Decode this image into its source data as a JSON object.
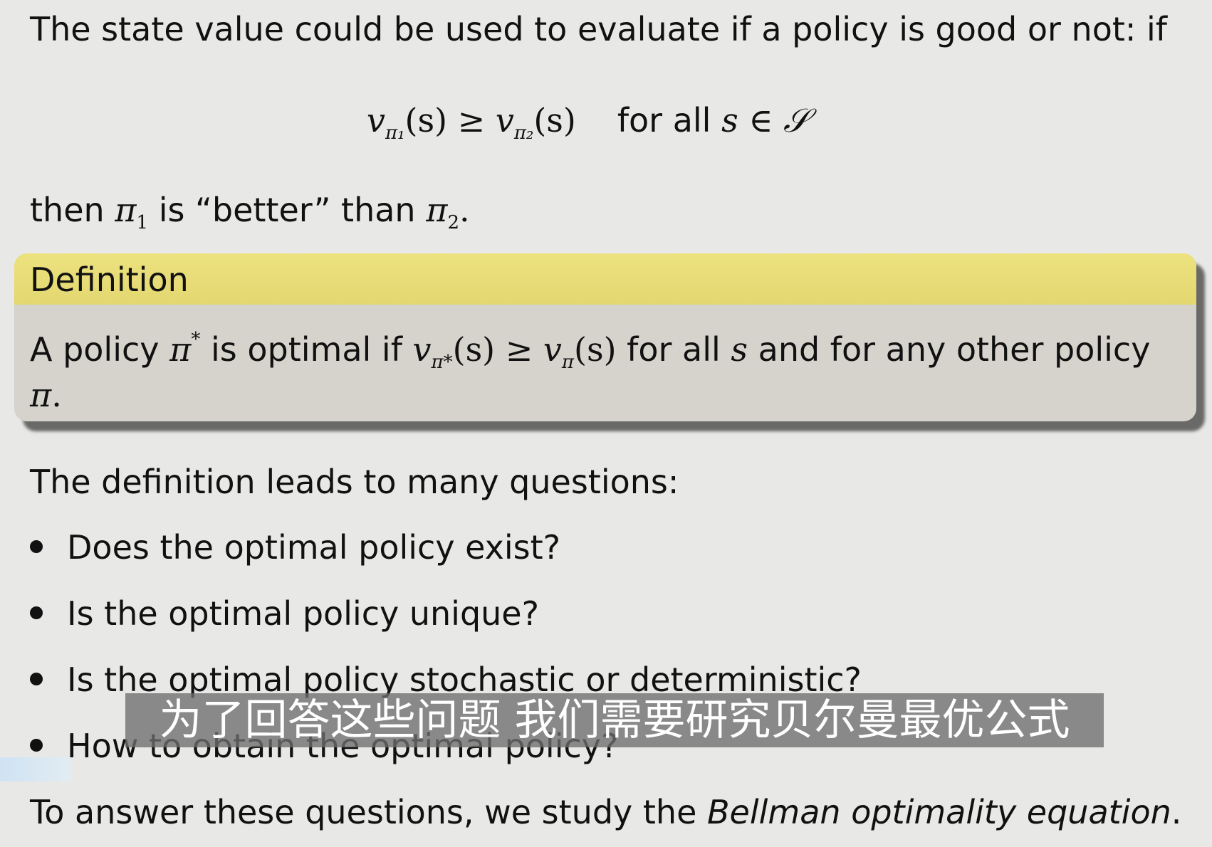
{
  "intro": "The state value could be used to evaluate if a policy is good or not:  if",
  "display": {
    "lhs": "v",
    "lhs_sub": "π₁",
    "arg": "(s)",
    "rel": "≥",
    "rhs": "v",
    "rhs_sub": "π₂",
    "arg2": "(s)",
    "text": "for all",
    "var": "s",
    "in": "∈",
    "set": "𝒮"
  },
  "then_line": {
    "pre": "then",
    "pi1": "π",
    "pi1_sub": "1",
    "mid": "is “better” than",
    "pi2": "π",
    "pi2_sub": "2",
    "end": "."
  },
  "definition": {
    "title": "Definition",
    "l1_a": "A policy",
    "l1_pi": "π",
    "l1_star": "*",
    "l1_b": "is optimal if",
    "l1_v": "v",
    "l1_vsub": "π*",
    "l1_arg": "(s)",
    "l1_rel": "≥",
    "l1_v2": "v",
    "l1_v2sub": "π",
    "l1_arg2": "(s)",
    "l1_c": "for all",
    "l1_s": "s",
    "l1_d": "and for any other policy",
    "l2_pi": "π",
    "l2_end": "."
  },
  "lead": "The definition leads to many questions:",
  "bullets": [
    "Does the optimal policy exist?",
    "Is the optimal policy unique?",
    "Is the optimal policy stochastic or deterministic?",
    "How to obtain the optimal policy?"
  ],
  "answer": {
    "pre": "To answer these questions, we study the",
    "emph": "Bellman optimality equation",
    "end": "."
  },
  "subtitle": "为了回答这些问题 我们需要研究贝尔曼最优公式"
}
